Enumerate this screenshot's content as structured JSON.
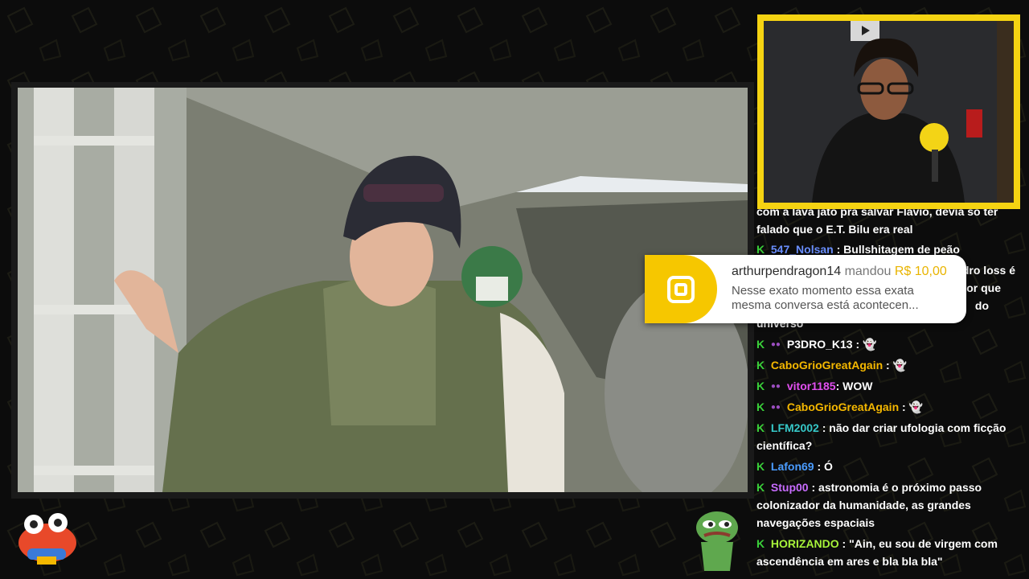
{
  "colors": {
    "accent_yellow": "#f5d312",
    "chat_badge_green": "#3ad13a"
  },
  "donation": {
    "name": "arthurpendragon14",
    "verb": "mandou",
    "amount": "R$ 10,00",
    "message_line1": "Nesse exato momento essa exata",
    "message_line2": "mesma conversa está acontecen..."
  },
  "chat": {
    "partial_lines": [
      "com a lava jato pra salvar Flavio, devia so ter",
      "falado que o E.T. Bilu era real"
    ],
    "messages": [
      {
        "user": "547_Nolsan",
        "user_color": "#6a8fff",
        "text": "Bullshitagem de peão"
      },
      {
        "fragment_a": "dro loss é",
        "fragment_b": "or que",
        "fragment_c": "do",
        "fragment_d": "universo"
      },
      {
        "user": "P3DRO_K13",
        "user_color": "#ffffff",
        "text": "",
        "emote": "ghost-emote"
      },
      {
        "user": "CaboGrioGreatAgain",
        "user_color": "#f5b800",
        "text": "",
        "emote": "ghost-emote"
      },
      {
        "user": "vitor1185",
        "user_color": "#e24ff0",
        "text": "WOW"
      },
      {
        "user": "CaboGrioGreatAgain",
        "user_color": "#f5b800",
        "text": "",
        "emote": "ghost-emote"
      },
      {
        "user": "LFM2002",
        "user_color": "#36c8c8",
        "text": "não dar criar ufologia com ficção",
        "text2": "científica?"
      },
      {
        "user": "Lafon69",
        "user_color": "#4a9cff",
        "text": "Ó"
      },
      {
        "user": "Stup00",
        "user_color": "#c86cff",
        "text": "astronomia é o próximo passo",
        "text2": "colonizador da humanidade, as grandes",
        "text3": "navegações espaciais"
      },
      {
        "user": "HORIZANDO",
        "user_color": "#a6f23a",
        "text": "\"Ain, eu sou de virgem com",
        "text2": "ascendência em ares e bla bla bla\""
      }
    ]
  }
}
